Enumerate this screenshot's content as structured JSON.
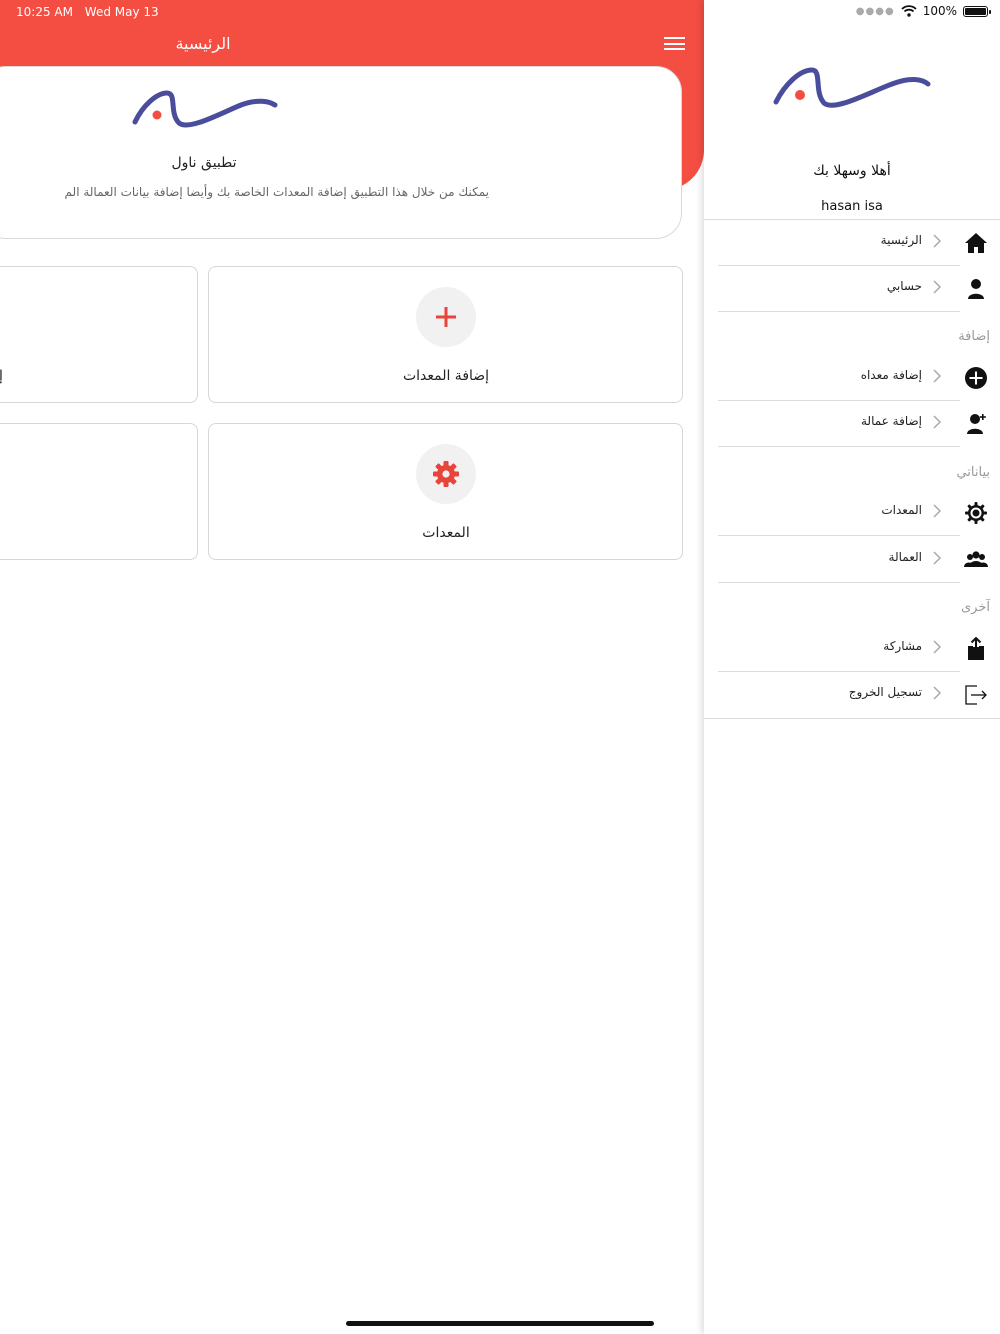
{
  "status_bar": {
    "time": "10:25 AM",
    "date": "Wed May 13",
    "battery": "100%"
  },
  "header": {
    "title": "الرئيسية"
  },
  "info_card": {
    "title": "تطبيق ناول",
    "description": "يمكنك من خلال هذا التطبيق إضافة المعدات الخاصة بك وأيضا إضافة بيانات العمالة الم"
  },
  "tiles": {
    "add_equipment": {
      "label": "إضافة المعدات",
      "icon": "plus-icon"
    },
    "equipment": {
      "label": "المعدات",
      "icon": "gear-icon"
    },
    "left_partial": {
      "label": "إ"
    }
  },
  "drawer": {
    "welcome": "أهلا وسهلا بك",
    "username": "hasan isa",
    "items": [
      {
        "label": "الرئيسية",
        "icon": "home-icon"
      },
      {
        "label": "حسابي",
        "icon": "user-icon"
      },
      {
        "label": "إضافة معداه",
        "icon": "plus-circle-icon"
      },
      {
        "label": "إضافة عمالة",
        "icon": "add-worker-icon"
      },
      {
        "label": "المعدات",
        "icon": "gear-icon"
      },
      {
        "label": "العمالة",
        "icon": "workers-icon"
      },
      {
        "label": "مشاركة",
        "icon": "share-icon"
      },
      {
        "label": "تسجيل الخروج",
        "icon": "logout-icon"
      }
    ],
    "sections": {
      "add": "إضافة",
      "my_data": "بياناتي",
      "other": "آخرى"
    }
  },
  "colors": {
    "accent": "#f44e42",
    "logo_blue": "#4a4d9c",
    "logo_red": "#f44e42"
  }
}
